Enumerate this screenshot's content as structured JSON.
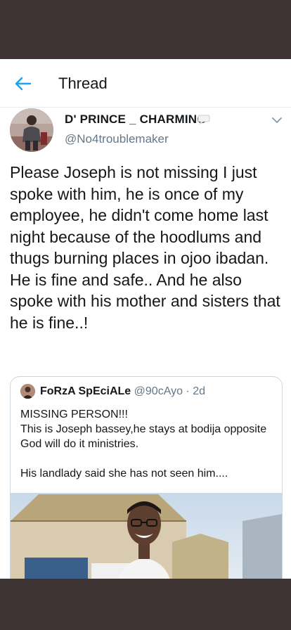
{
  "header": {
    "title": "Thread"
  },
  "tweet": {
    "author_name": "D' PRINCE _ CHARMING",
    "handle": "@No4troublemaker",
    "text": "Please Joseph is not missing I just spoke with him, he is once of my employee, he didn't come home last night because of the hoodlums and thugs burning places in ojoo ibadan. He is fine and safe.. And he also spoke with his mother and sisters that he is fine..!"
  },
  "quoted_tweet": {
    "author_name": "FoRzA SpEciALe",
    "handle": "@90cAyo",
    "separator": " · ",
    "time": "2d",
    "line1": "MISSING PERSON!!!",
    "line2": "This is Joseph bassey,he stays at bodija opposite God will do it ministries.",
    "line3": "His landlady said she has not seen him...."
  },
  "colors": {
    "accent": "#1da1f2",
    "text": "#14171a",
    "secondary": "#657786",
    "frame": "#3d3333"
  }
}
